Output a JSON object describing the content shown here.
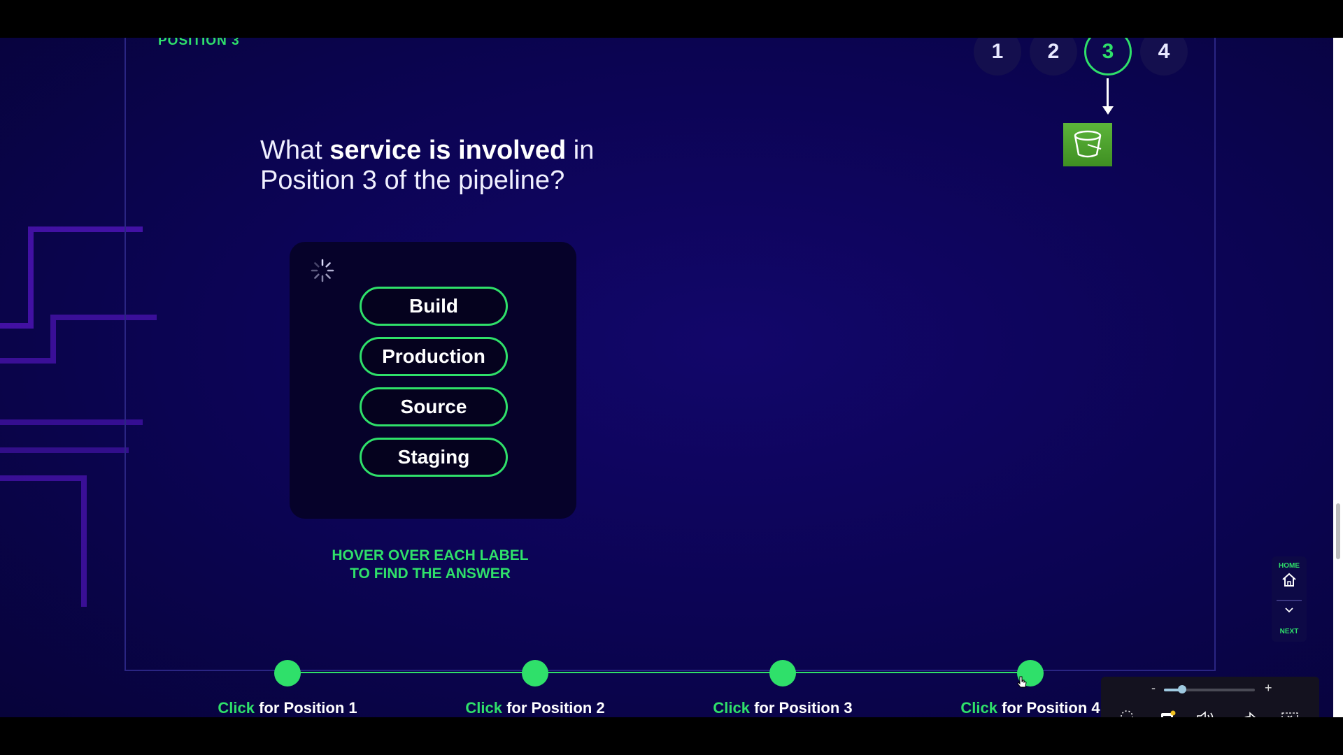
{
  "header": {
    "position_title": "POSITION 3",
    "steps": [
      "1",
      "2",
      "3",
      "4"
    ],
    "active_step": "3"
  },
  "question": {
    "prefix": "What ",
    "bold": "service is involved",
    "suffix_line1": " in",
    "line2": "Position 3 of the pipeline?"
  },
  "answers": [
    "Build",
    "Production",
    "Source",
    "Staging"
  ],
  "hint": {
    "line1": "HOVER OVER EACH LABEL",
    "line2": "TO FIND THE ANSWER"
  },
  "timeline": {
    "click_word": "Click",
    "positions": [
      "for Position 1",
      "for Position 2",
      "for Position 3",
      "for Position 4"
    ]
  },
  "side_nav": {
    "home_label": "HOME",
    "next_label": "NEXT"
  },
  "player": {
    "zoom_minus": "-",
    "zoom_plus": "+",
    "zoom_level": 0.2
  },
  "colors": {
    "accent": "#2fe06a",
    "background": "#0b0452",
    "bucket": "#4ea12e"
  },
  "icons": [
    "spinner-icon",
    "bucket-icon",
    "home-icon",
    "chevron-down-icon",
    "pointer-icon",
    "captions-icon",
    "volume-icon",
    "share-icon",
    "exit-fullscreen-icon"
  ]
}
